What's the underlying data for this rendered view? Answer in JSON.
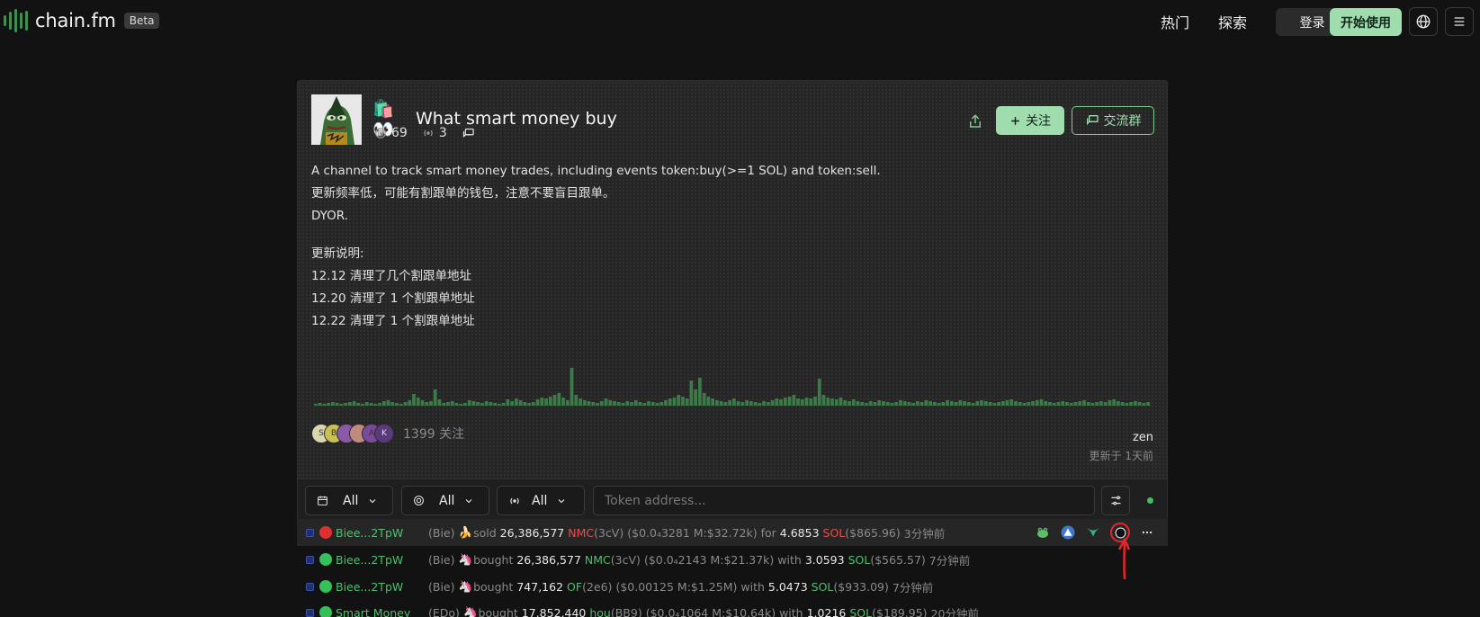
{
  "nav": {
    "logo_text": "chain.fm",
    "beta_label": "Beta",
    "hot_label": "热门",
    "explore_label": "探索",
    "login_label": "登录",
    "start_label": "开始使用",
    "language_icon": "globe-icon",
    "menu_icon": "hamburger-menu-icon"
  },
  "channel": {
    "title_emoji": "🛍️👀",
    "title": "What smart money buy",
    "listeners": "69",
    "signal_count": "3",
    "follow_label": "关注",
    "group_label": "交流群",
    "description": [
      "A channel to track smart money trades, including events token:buy(>=1 SOL) and token:sell.",
      "更新频率低，可能有割跟单的钱包，注意不要盲目跟单。",
      "DYOR."
    ],
    "changelog": [
      "更新说明:",
      "12.12 清理了几个割跟单地址",
      "12.20 清理了 1 个割跟单地址",
      "12.22 清理了 1 个割跟单地址"
    ],
    "follower_avatars": [
      "S",
      "B",
      "",
      "",
      "A",
      "K"
    ],
    "follower_count_text": "1399 关注",
    "owner": "zen",
    "updated": "更新于 1天前"
  },
  "filters": {
    "date_value": "All",
    "source_value": "All",
    "signal_value": "All",
    "token_placeholder": "Token address..."
  },
  "activity": [
    {
      "status": "red",
      "wallet": "Biee...2TpW",
      "alias": "(Bie)",
      "emoji": "🍌",
      "action": "sold",
      "action_color": "red",
      "amount": "26,386,577",
      "token": "NMC",
      "token_code": "(3cV)",
      "price": "($0.0₄3281 M:$32.72k)",
      "connector": "for",
      "value": "4.6853",
      "base": "SOL",
      "base_usd": "($865.96)",
      "time": "3分钟前"
    },
    {
      "status": "green",
      "wallet": "Biee...2TpW",
      "alias": "(Bie)",
      "emoji": "🦄",
      "action": "bought",
      "action_color": "green",
      "amount": "26,386,577",
      "token": "NMC",
      "token_code": "(3cV)",
      "price": "($0.0₄2143 M:$21.37k)",
      "connector": "with",
      "value": "3.0593",
      "base": "SOL",
      "base_usd": "($565.57)",
      "time": "7分钟前"
    },
    {
      "status": "green",
      "wallet": "Biee...2TpW",
      "alias": "(Bie)",
      "emoji": "🦄",
      "action": "bought",
      "action_color": "green",
      "amount": "747,162",
      "token": "OF",
      "token_code": "(2e6)",
      "price": "($0.00125 M:$1.25M)",
      "connector": "with",
      "value": "5.0473",
      "base": "SOL",
      "base_usd": "($933.09)",
      "time": "7分钟前"
    },
    {
      "status": "green",
      "wallet": "Smart Money",
      "alias": "(EDo)",
      "emoji": "🦄",
      "action": "bought",
      "action_color": "green",
      "amount": "17,852,440",
      "token": "hou",
      "token_code": "(BB9)",
      "price": "($0.0₄1064 M:$10.64k)",
      "connector": "with",
      "value": "1.0216",
      "base": "SOL",
      "base_usd": "($189.95)",
      "time": "20分钟前"
    }
  ],
  "row_action_icons": [
    "frog-icon",
    "triangle-icon",
    "bull-icon",
    "crescent-icon",
    "more-icon"
  ]
}
